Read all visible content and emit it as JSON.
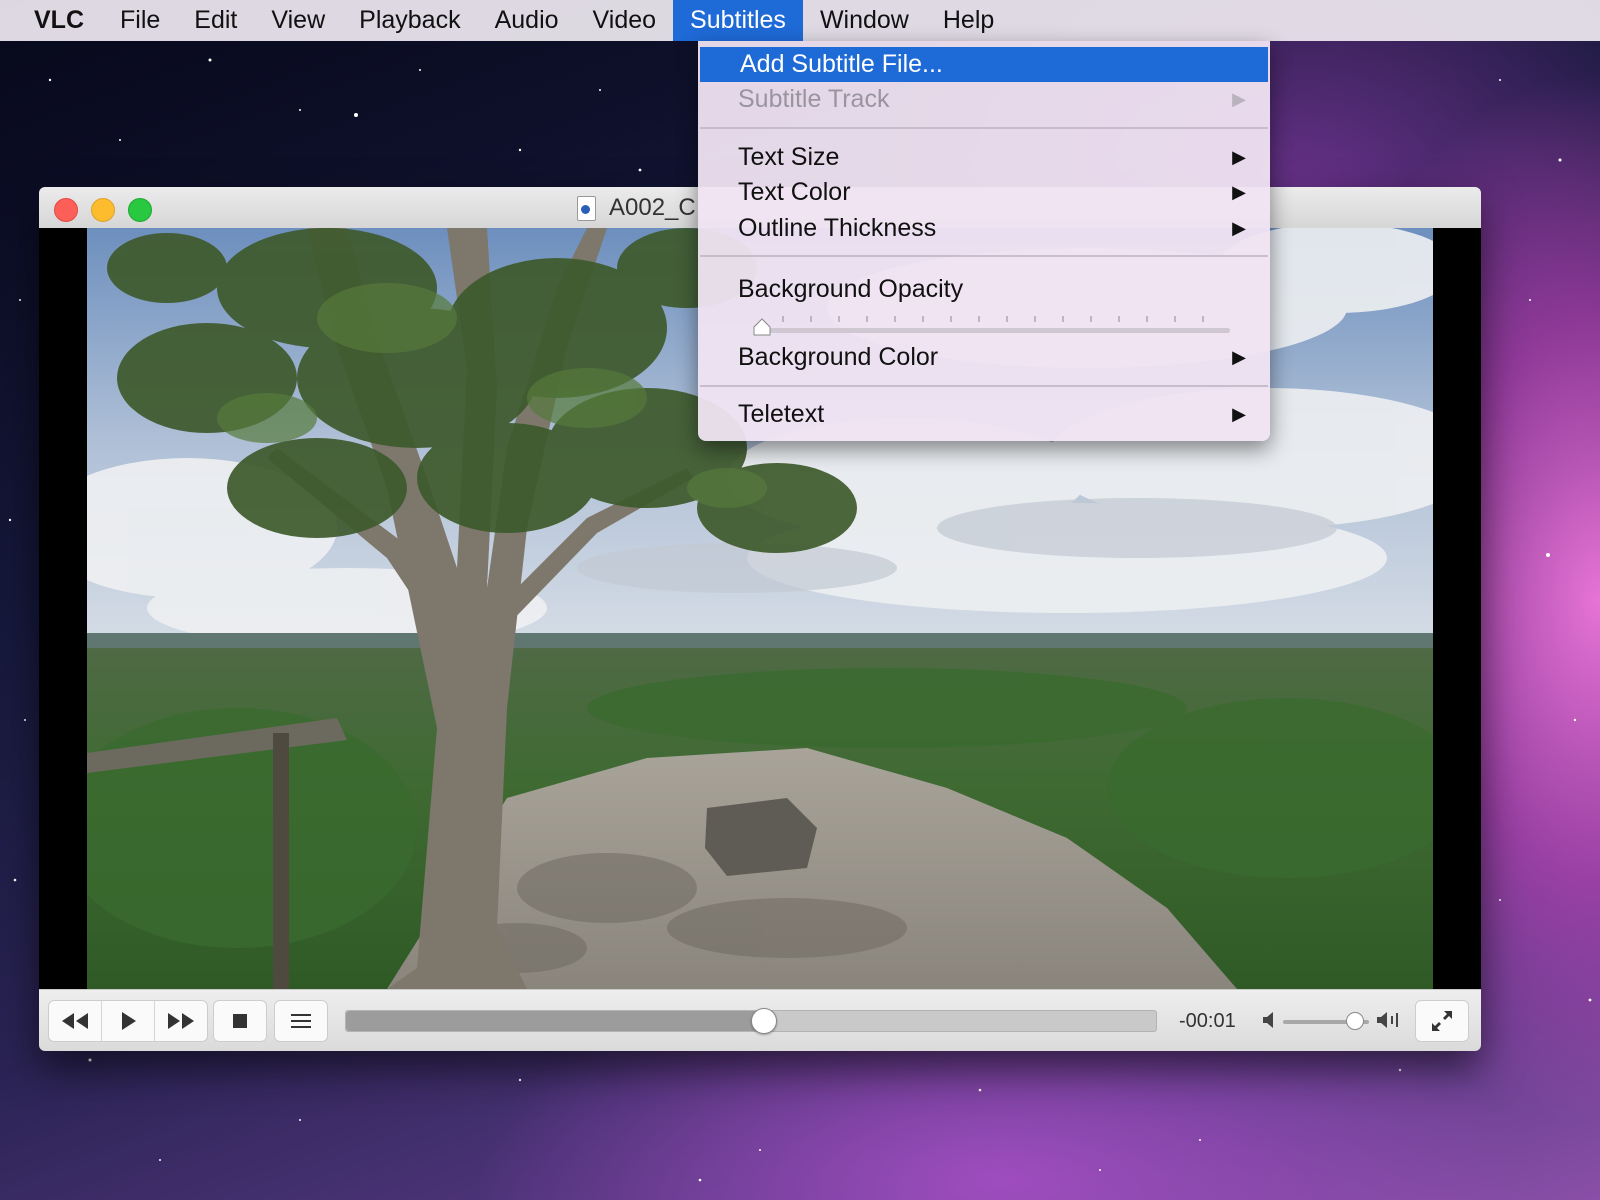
{
  "menubar": {
    "app": "VLC",
    "items": [
      "File",
      "Edit",
      "View",
      "Playback",
      "Audio",
      "Video",
      "Subtitles",
      "Window",
      "Help"
    ],
    "active_item": "Subtitles"
  },
  "subtitles_menu": {
    "add_subtitle_file": "Add Subtitle File...",
    "subtitle_track": "Subtitle Track",
    "text_size": "Text Size",
    "text_color": "Text Color",
    "outline_thickness": "Outline Thickness",
    "background_opacity": "Background Opacity",
    "background_opacity_value": 0.0,
    "background_color": "Background Color",
    "teletext": "Teletext"
  },
  "window": {
    "title": "A002_C"
  },
  "controls": {
    "time_remaining": "-00:01",
    "seek_position": 0.515,
    "volume_level": 0.82
  },
  "colors": {
    "highlight": "#1e6ad6",
    "close": "#fc5f57",
    "minimize": "#fdbc2e",
    "maximize": "#28c840"
  }
}
